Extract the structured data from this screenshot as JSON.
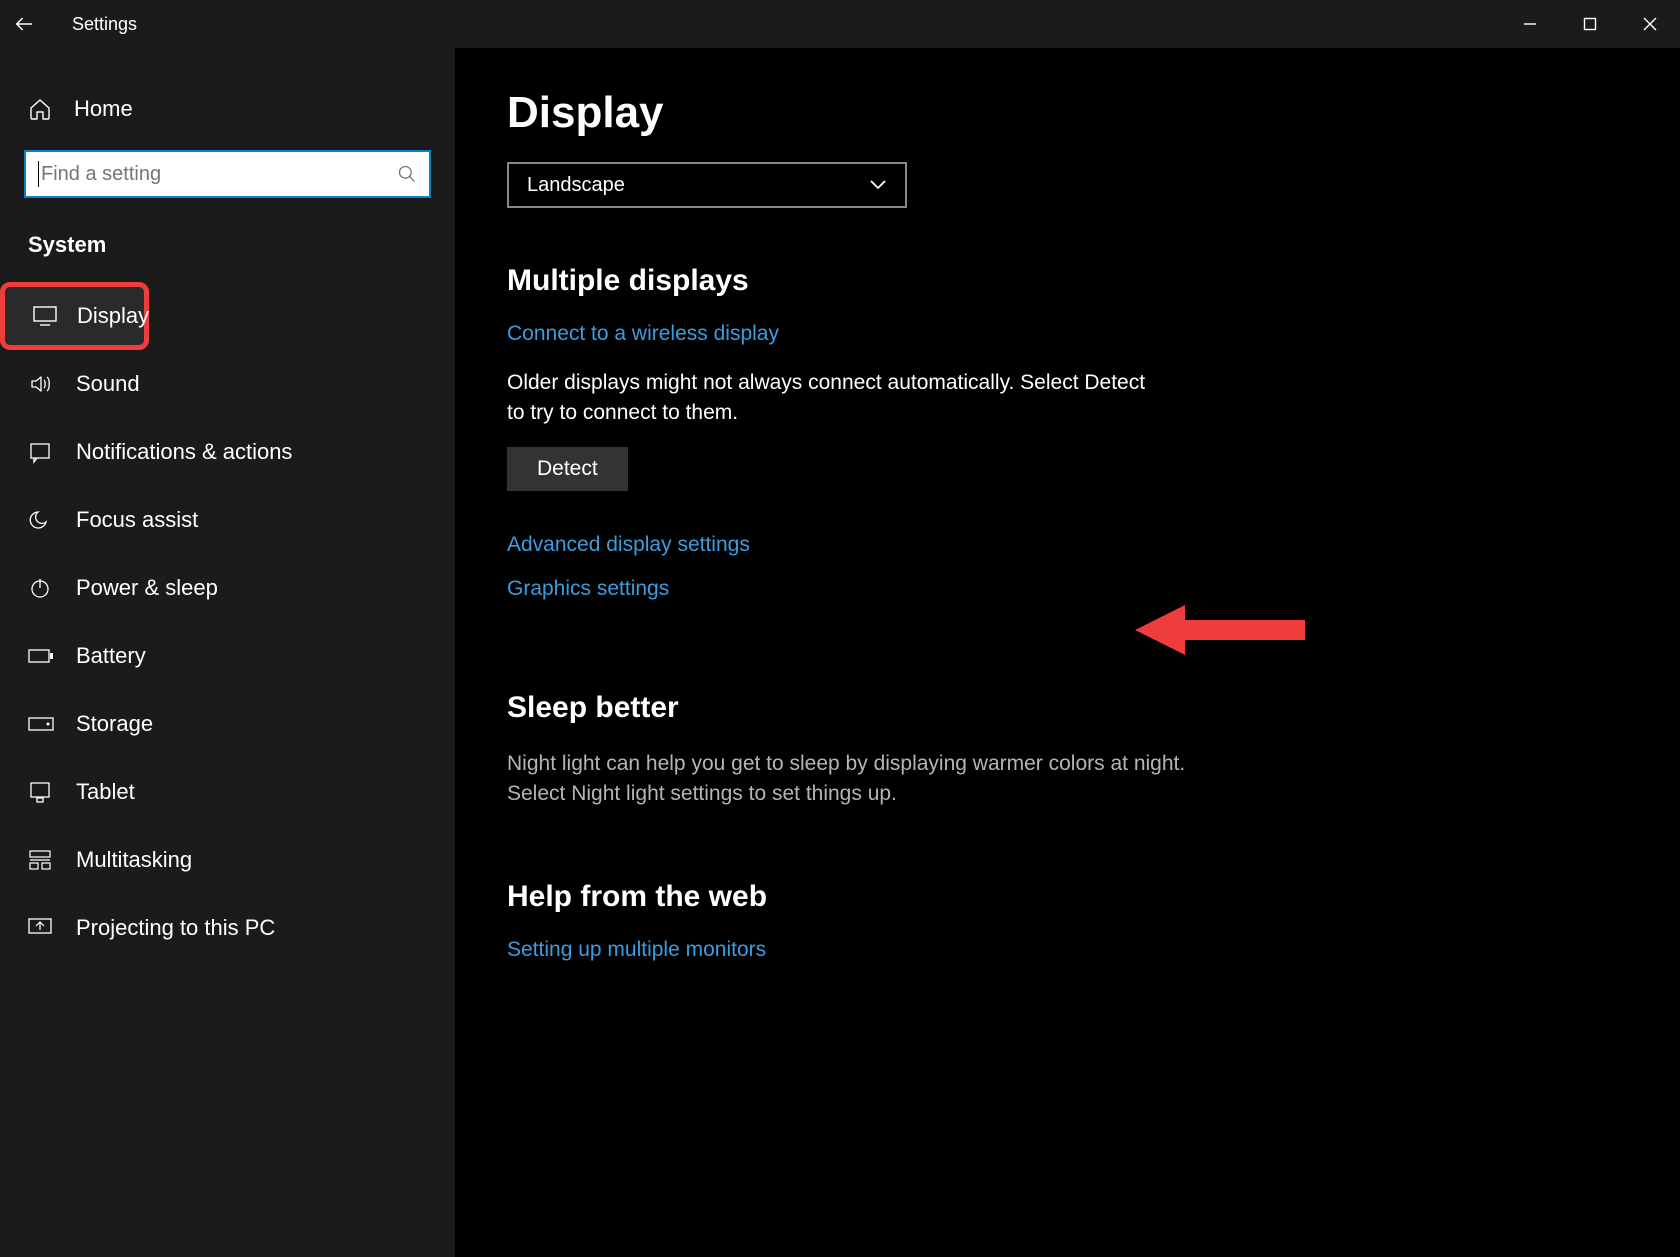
{
  "header": {
    "title": "Settings"
  },
  "sidebar": {
    "home": "Home",
    "search_placeholder": "Find a setting",
    "section": "System",
    "items": [
      {
        "label": "Display"
      },
      {
        "label": "Sound"
      },
      {
        "label": "Notifications & actions"
      },
      {
        "label": "Focus assist"
      },
      {
        "label": "Power & sleep"
      },
      {
        "label": "Battery"
      },
      {
        "label": "Storage"
      },
      {
        "label": "Tablet"
      },
      {
        "label": "Multitasking"
      },
      {
        "label": "Projecting to this PC"
      }
    ]
  },
  "main": {
    "title": "Display",
    "orientation_value": "Landscape",
    "multiple_displays_heading": "Multiple displays",
    "connect_link": "Connect to a wireless display",
    "older_text": "Older displays might not always connect automatically. Select Detect to try to connect to them.",
    "detect_label": "Detect",
    "advanced_link": "Advanced display settings",
    "graphics_link": "Graphics settings",
    "sleep_heading": "Sleep better",
    "sleep_text": "Night light can help you get to sleep by displaying warmer colors at night. Select Night light settings to set things up.",
    "help_heading": "Help from the web",
    "help_link1": "Setting up multiple monitors"
  }
}
